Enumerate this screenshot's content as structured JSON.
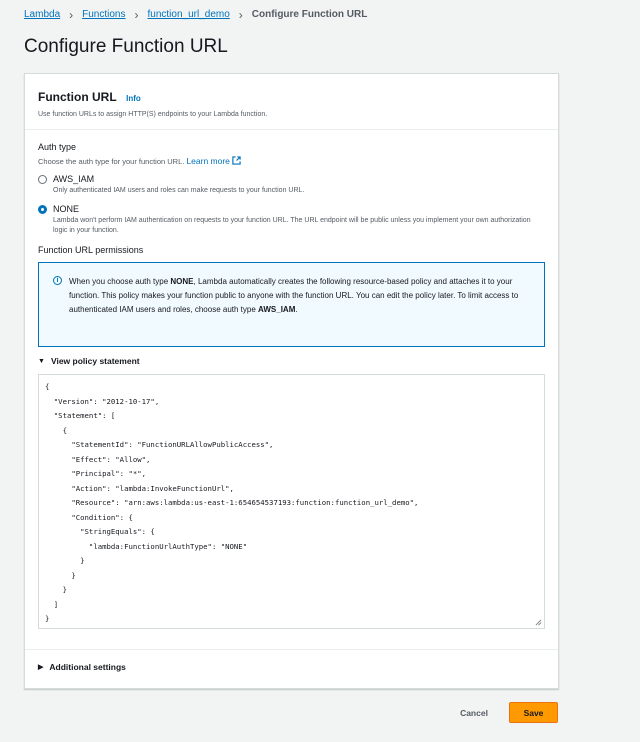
{
  "breadcrumb": {
    "items": [
      "Lambda",
      "Functions",
      "function_url_demo"
    ],
    "current": "Configure Function URL"
  },
  "page_title": "Configure Function URL",
  "card": {
    "title": "Function URL",
    "info_link": "Info",
    "description": "Use function URLs to assign HTTP(S) endpoints to your Lambda function."
  },
  "auth": {
    "label": "Auth type",
    "description": "Choose the auth type for your function URL.",
    "learn_more": "Learn more",
    "options": [
      {
        "label": "AWS_IAM",
        "description": "Only authenticated IAM users and roles can make requests to your function URL.",
        "selected": false
      },
      {
        "label": "NONE",
        "description": "Lambda won't perform IAM authentication on requests to your function URL. The URL endpoint will be public unless you implement your own authorization logic in your function.",
        "selected": true
      }
    ]
  },
  "permissions": {
    "label": "Function URL permissions",
    "info_pre": "When you choose auth type ",
    "info_bold1": "NONE",
    "info_mid": ", Lambda automatically creates the following resource-based policy and attaches it to your function. This policy makes your function public to anyone with the function URL. You can edit the policy later. To limit access to authenticated IAM users and roles, choose auth type ",
    "info_bold2": "AWS_IAM",
    "info_post": "."
  },
  "policy": {
    "expander_label": "View policy statement",
    "code": "{\n  \"Version\": \"2012-10-17\",\n  \"Statement\": [\n    {\n      \"StatementId\": \"FunctionURLAllowPublicAccess\",\n      \"Effect\": \"Allow\",\n      \"Principal\": \"*\",\n      \"Action\": \"lambda:InvokeFunctionUrl\",\n      \"Resource\": \"arn:aws:lambda:us-east-1:654654537193:function:function_url_demo\",\n      \"Condition\": {\n        \"StringEquals\": {\n          \"lambda:FunctionUrlAuthType\": \"NONE\"\n        }\n      }\n    }\n  ]\n}"
  },
  "additional_settings": "Additional settings",
  "actions": {
    "cancel": "Cancel",
    "save": "Save"
  },
  "colors": {
    "link": "#0073bb",
    "primary_button": "#ff9900",
    "info_bg": "#f1faff",
    "page_bg": "#f2f3f3"
  }
}
